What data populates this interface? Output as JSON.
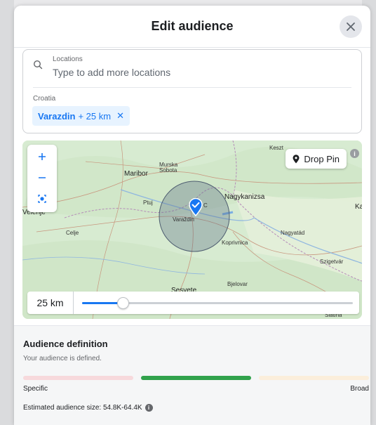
{
  "modal": {
    "title": "Edit audience"
  },
  "locations": {
    "label": "Locations",
    "placeholder": "Type to add more locations",
    "country": "Croatia",
    "selected": {
      "city": "Varazdin",
      "radius": "+ 25 km"
    }
  },
  "map": {
    "drop_pin_label": "Drop Pin",
    "places": {
      "maribor": "Maribor",
      "murska": "Murska",
      "sobota": "Sobota",
      "ptuj": "Ptuj",
      "velenje": "Velenje",
      "celje": "Celje",
      "nagykanizsa": "Nagykanizsa",
      "kapo": "Kapo",
      "varazdin": "Varaždin",
      "koprivnica": "Koprivnica",
      "nagyatad": "Nagyatád",
      "szigetvar": "Szigetvár",
      "bjelovar": "Bjelovar",
      "sesvete": "Sesvete",
      "keszt": "Keszt",
      "slatina": "Slatina",
      "c": "C"
    },
    "radius_value": "25 km",
    "radius_fraction": 0.15
  },
  "audience": {
    "title": "Audience definition",
    "status": "Your audience is defined.",
    "specific_label": "Specific",
    "broad_label": "Broad",
    "estimate": "Estimated audience size: 54.8K-64.4K",
    "colors": {
      "specific": "#f7d9dc",
      "defined": "#31a24c",
      "broad": "#fbeedb"
    }
  },
  "accent_color": "#1877f2"
}
